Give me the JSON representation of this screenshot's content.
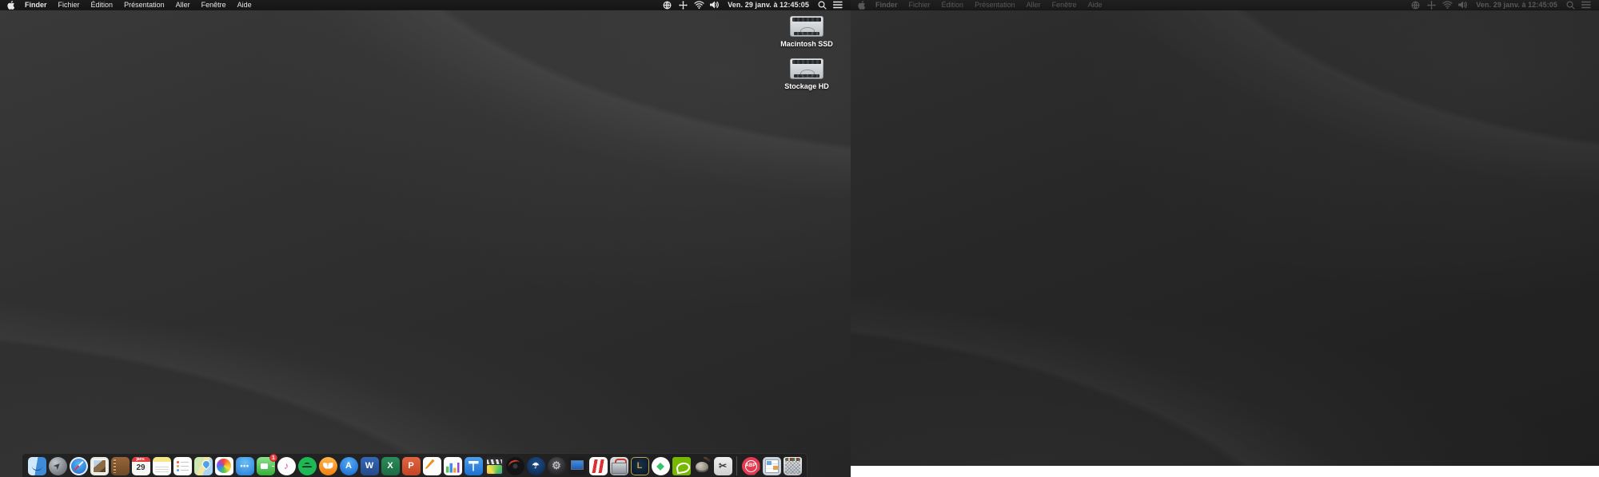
{
  "menu_bar": {
    "apple_icon": "apple-logo-icon",
    "menus": [
      "Finder",
      "Fichier",
      "Édition",
      "Présentation",
      "Aller",
      "Fenêtre",
      "Aide"
    ],
    "active_app_index": 0,
    "status_icons_left_of_clock": [
      "globe-status-icon",
      "crosshair-status-icon",
      "wifi-icon",
      "volume-icon"
    ],
    "clock": "Ven. 29 janv. à 12:45:05",
    "status_icons_right_of_clock": [
      "spotlight-search-icon",
      "notification-list-icon"
    ]
  },
  "desktop_icons": [
    {
      "label": "Macintosh SSD"
    },
    {
      "label": "Stockage HD"
    }
  ],
  "dock": {
    "items": [
      {
        "key": "finder",
        "name": "finder-dock-icon",
        "glyph": ""
      },
      {
        "key": "launchpad",
        "name": "launchpad-dock-icon",
        "glyph": "➤"
      },
      {
        "key": "safari",
        "name": "safari-dock-icon",
        "glyph": ""
      },
      {
        "key": "preview",
        "name": "preview-photo-dock-icon",
        "glyph": ""
      },
      {
        "key": "contacts",
        "name": "contacts-dock-icon",
        "glyph": ""
      },
      {
        "key": "calendar",
        "name": "calendar-dock-icon",
        "glyph": "29",
        "month": "janv."
      },
      {
        "key": "notes",
        "name": "notes-dock-icon",
        "glyph": ""
      },
      {
        "key": "reminders",
        "name": "reminders-dock-icon",
        "glyph": ""
      },
      {
        "key": "maps",
        "name": "maps-dock-icon",
        "glyph": ""
      },
      {
        "key": "photos",
        "name": "photos-dock-icon",
        "glyph": ""
      },
      {
        "key": "messages",
        "name": "messages-dock-icon",
        "glyph": "•••"
      },
      {
        "key": "facetime",
        "name": "facetime-dock-icon",
        "glyph": "",
        "badge": "1"
      },
      {
        "key": "itunes",
        "name": "itunes-dock-icon",
        "glyph": "♪"
      },
      {
        "key": "spotify",
        "name": "spotify-dock-icon",
        "glyph": ""
      },
      {
        "key": "books",
        "name": "books-dock-icon",
        "glyph": ""
      },
      {
        "key": "appstore",
        "name": "app-store-dock-icon",
        "glyph": "A"
      },
      {
        "key": "word",
        "name": "microsoft-word-dock-icon",
        "glyph": "W"
      },
      {
        "key": "excel",
        "name": "microsoft-excel-dock-icon",
        "glyph": "X"
      },
      {
        "key": "powerpoint",
        "name": "microsoft-powerpoint-dock-icon",
        "glyph": "P"
      },
      {
        "key": "pages",
        "name": "pages-dock-icon",
        "glyph": ""
      },
      {
        "key": "numbers",
        "name": "numbers-dock-icon",
        "glyph": ""
      },
      {
        "key": "keynote",
        "name": "keynote-dock-icon",
        "glyph": ""
      },
      {
        "key": "imovie",
        "name": "imovie-dock-icon",
        "glyph": ""
      },
      {
        "key": "vinyl",
        "name": "vinyl-record-app-dock-icon",
        "glyph": ""
      },
      {
        "key": "flcircle",
        "name": "umbrella-circle-app-dock-icon",
        "glyph": "☂"
      },
      {
        "key": "geardisc",
        "name": "gear-utility-dock-icon",
        "glyph": "⚙"
      },
      {
        "key": "winpc",
        "name": "windows-pc-dock-icon",
        "glyph": ""
      },
      {
        "key": "parallels",
        "name": "parallels-desktop-dock-icon",
        "glyph": ""
      },
      {
        "key": "toolbox",
        "name": "toolbox-app-dock-icon",
        "glyph": ""
      },
      {
        "key": "lol",
        "name": "league-of-legends-dock-icon",
        "glyph": "L"
      },
      {
        "key": "sims",
        "name": "sims-plumbob-dock-icon",
        "glyph": "◆"
      },
      {
        "key": "nvidia",
        "name": "nvidia-geforce-dock-icon",
        "glyph": ""
      },
      {
        "key": "gimp",
        "name": "gimp-dock-icon",
        "glyph": ""
      },
      {
        "key": "screenshot",
        "name": "screenshot-tool-dock-icon",
        "glyph": "✂"
      },
      {
        "key": "separator",
        "name": "dock-separator",
        "glyph": ""
      },
      {
        "key": "abp",
        "name": "adblock-plus-dock-icon",
        "glyph": "ABP"
      },
      {
        "key": "downloads",
        "name": "downloads-stack-dock-icon",
        "glyph": ""
      },
      {
        "key": "trash",
        "name": "trash-dock-icon",
        "glyph": ""
      }
    ]
  },
  "colors": {
    "menubar_bg": "#1a1a1a",
    "menubar_text": "#e6e6e6",
    "menubar_text_dim": "#8a8a8a",
    "wallpaper_base": "#303030",
    "dock_bg": "rgba(30,30,32,0.82)",
    "badge_red": "#ec3e3e",
    "calendar_red": "#e23b3b",
    "spotify_green": "#1db954",
    "nvidia_green": "#76b900"
  }
}
